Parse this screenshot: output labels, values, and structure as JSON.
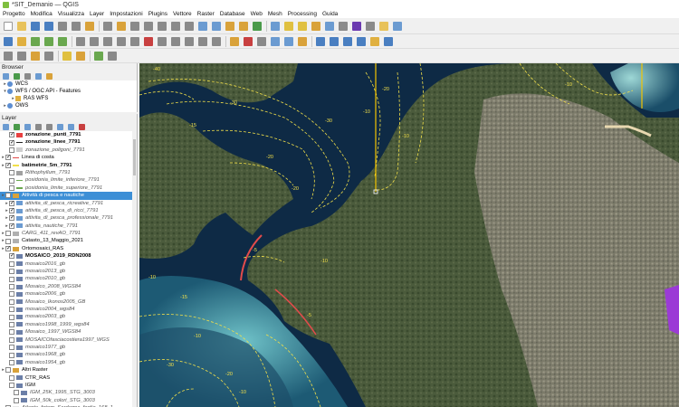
{
  "window": {
    "title": "*SIT_Demanio — QGIS"
  },
  "menu": [
    "Progetto",
    "Modifica",
    "Visualizza",
    "Layer",
    "Impostazioni",
    "Plugins",
    "Vettore",
    "Raster",
    "Database",
    "Web",
    "Mesh",
    "Processing",
    "Guida"
  ],
  "colors": {
    "selection": "#3d8fd6",
    "contour": "#f2e04a",
    "water_deep": "#0e2a45",
    "land": "#4a5a3a"
  },
  "browser": {
    "title": "Browser",
    "items": [
      {
        "label": "WCS",
        "icon": "globe-icon"
      },
      {
        "label": "WFS / OGC API - Features",
        "icon": "globe-icon"
      },
      {
        "label": "RAS WFS",
        "icon": "wfs-layer-icon"
      },
      {
        "label": "OWS",
        "icon": "globe-icon"
      }
    ]
  },
  "layers": {
    "title": "Layer",
    "rows": [
      {
        "label": "zonazione_punti_7791",
        "style": "b",
        "checked": true
      },
      {
        "label": "zonazione_linee_7791",
        "style": "b",
        "checked": true
      },
      {
        "label": "zonazione_poligoni_7791",
        "style": "i",
        "checked": false
      },
      {
        "label": "Linea di costa",
        "style": "",
        "checked": true
      },
      {
        "label": "batimetrie_5m_7791",
        "style": "b",
        "checked": true
      },
      {
        "label": "Rithophyllum_7791",
        "style": "i",
        "checked": false
      },
      {
        "label": "posidonia_limite_inferiore_7791",
        "style": "i",
        "checked": false
      },
      {
        "label": "posidonia_limite_superiore_7791",
        "style": "i",
        "checked": false
      },
      {
        "label": "Attività di pesca e nautiche",
        "style": "",
        "checked": false,
        "selected": true
      },
      {
        "label": "attivita_di_pesca_ricreative_7791",
        "style": "i",
        "checked": true
      },
      {
        "label": "attivita_di_pesca_di_ricci_7791",
        "style": "i",
        "checked": true
      },
      {
        "label": "attivita_di_pesca_professionale_7791",
        "style": "i",
        "checked": true
      },
      {
        "label": "attivita_nautiche_7791",
        "style": "i",
        "checked": true
      },
      {
        "label": "CARG_411_revAO_7791",
        "style": "i",
        "checked": false
      },
      {
        "label": "Catasto_13_Maggio_2021",
        "style": "",
        "checked": false
      },
      {
        "label": "Ortomosaici_RAS",
        "style": "",
        "checked": true
      },
      {
        "label": "MOSAICO_2019_RDN2008",
        "style": "b",
        "checked": true
      },
      {
        "label": "mosaico2016_gb",
        "style": "i",
        "checked": false
      },
      {
        "label": "mosaico2013_gb",
        "style": "i",
        "checked": false
      },
      {
        "label": "mosaico2010_gb",
        "style": "i",
        "checked": false
      },
      {
        "label": "Mosaico_2008_WGS84",
        "style": "i",
        "checked": false
      },
      {
        "label": "mosaico2006_gb",
        "style": "i",
        "checked": false
      },
      {
        "label": "Mosaico_Ikonos2005_GB",
        "style": "i",
        "checked": false
      },
      {
        "label": "mosaico2004_wgs84",
        "style": "i",
        "checked": false
      },
      {
        "label": "mosaico2003_gb",
        "style": "i",
        "checked": false
      },
      {
        "label": "mosaico1998_1999_wgs84",
        "style": "i",
        "checked": false
      },
      {
        "label": "Mosaico_1997_WGS84",
        "style": "i",
        "checked": false
      },
      {
        "label": "MOSAICOfasciacostiera1997_WGS",
        "style": "i",
        "checked": false
      },
      {
        "label": "mosaico1977_gb",
        "style": "i",
        "checked": false
      },
      {
        "label": "mosaico1968_gb",
        "style": "i",
        "checked": false
      },
      {
        "label": "mosaico1954_gb",
        "style": "i",
        "checked": false
      },
      {
        "label": "Altri Raster",
        "style": "",
        "checked": false
      },
      {
        "label": "CTR_RAS",
        "style": "",
        "checked": false
      },
      {
        "label": "IGM",
        "style": "",
        "checked": false
      },
      {
        "label": "IGM_25K_1995_STG_3003",
        "style": "i",
        "checked": false
      },
      {
        "label": "IGM_50k_colori_STG_3003",
        "style": "i",
        "checked": false
      },
      {
        "label": "Atlante_fotogr_Sardegna_foglio_168_1...",
        "style": "i",
        "checked": false
      }
    ]
  },
  "map": {
    "contour_labels": [
      "-40",
      "-30",
      "-20",
      "-10",
      "-10",
      "-10",
      "-15",
      "-20",
      "-30",
      "-10",
      "-5",
      "-10",
      "-20",
      "-20",
      "-10",
      "-15",
      "-30",
      "-10",
      "-5"
    ]
  }
}
